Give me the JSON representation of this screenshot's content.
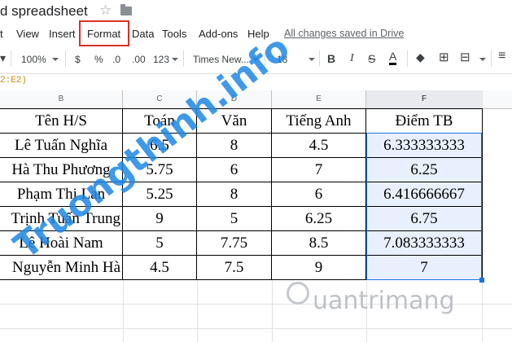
{
  "title": "d spreadsheet",
  "menu": [
    "t",
    "View",
    "Insert",
    "Format",
    "Data",
    "Tools",
    "Add-ons",
    "Help"
  ],
  "save_status": "All changes saved in Drive",
  "toolbar": {
    "zoom": "100%",
    "currency": "$",
    "percent": "%",
    "dec_less": ".0",
    "dec_more": ".00",
    "format_more": "123",
    "font": "Times New...",
    "font_size": "18",
    "bold": "B",
    "italic": "I",
    "strike": "S",
    "text_color": "A"
  },
  "formula": "2:E2)",
  "columns": [
    "B",
    "C",
    "D",
    "E",
    "F"
  ],
  "rows": [
    [
      "Tên H/S",
      "Toán",
      "Văn",
      "Tiếng Anh",
      "Điểm TB"
    ],
    [
      "Lê Tuấn Nghĩa",
      "6.5",
      "8",
      "4.5",
      "6.333333333"
    ],
    [
      "Hà Thu Phương",
      "5.75",
      "6",
      "7",
      "6.25"
    ],
    [
      "Phạm Thị Lan",
      "5.25",
      "8",
      "6",
      "6.416666667"
    ],
    [
      "Trịnh Tuấn Trung",
      "9",
      "5",
      "6.25",
      "6.75"
    ],
    [
      "Lê Hoài Nam",
      "5",
      "7.75",
      "8.5",
      "7.083333333"
    ],
    [
      "Nguyễn Minh Hà",
      "4.5",
      "7.5",
      "9",
      "7"
    ]
  ],
  "watermark_left": "Truongthinh.info",
  "watermark_right": "uantrimang",
  "colors": {
    "selection": "#1a73e8",
    "highlight_box": "#d93025"
  }
}
